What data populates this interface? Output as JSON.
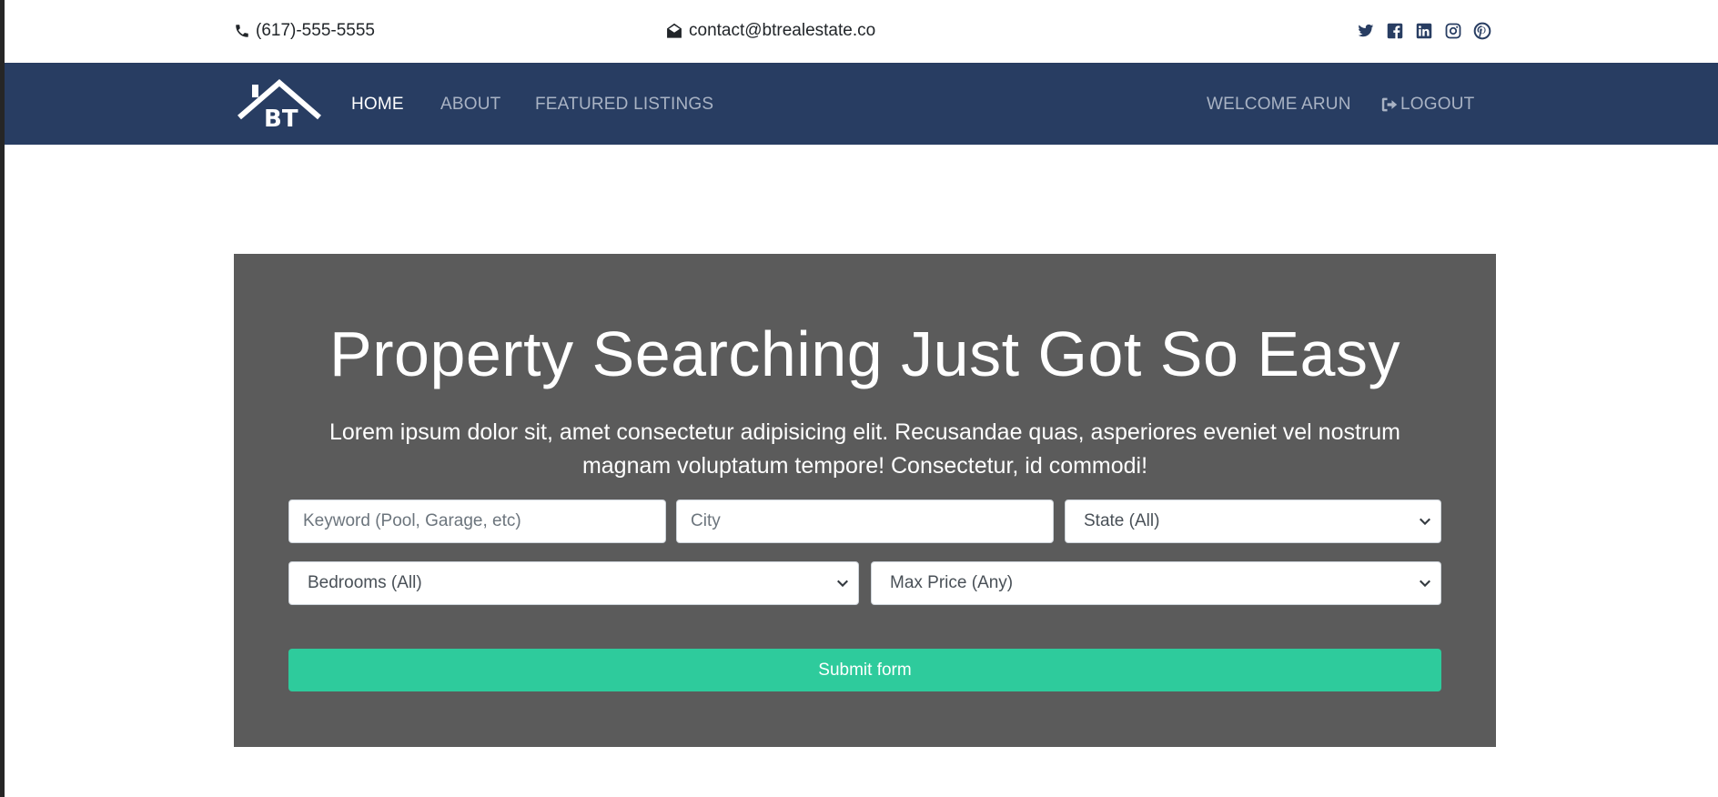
{
  "topbar": {
    "phone": "(617)-555-5555",
    "email": "contact@btrealestate.co",
    "social_icons": [
      "twitter-icon",
      "facebook-icon",
      "linkedin-icon",
      "instagram-icon",
      "pinterest-icon"
    ]
  },
  "navbar": {
    "logo_text": "BT",
    "links": {
      "home": "HOME",
      "about": "ABOUT",
      "featured": "FEATURED LISTINGS"
    },
    "welcome": "WELCOME ARUN",
    "logout": "LOGOUT"
  },
  "showcase": {
    "headline": "Property Searching Just Got So Easy",
    "lead": "Lorem ipsum dolor sit, amet consectetur adipisicing elit. Recusandae quas, asperiores eveniet vel nostrum magnam voluptatum tempore! Consectetur, id commodi!",
    "keyword_placeholder": "Keyword (Pool, Garage, etc)",
    "city_placeholder": "City",
    "state_selected": "State (All)",
    "bedrooms_selected": "Bedrooms (All)",
    "price_selected": "Max Price (Any)",
    "submit_label": "Submit form"
  },
  "colors": {
    "navbar_bg": "#283d62",
    "showcase_bg": "#5b5b5b",
    "submit_bg": "#2ecb9c",
    "social_icon": "#283d62"
  }
}
